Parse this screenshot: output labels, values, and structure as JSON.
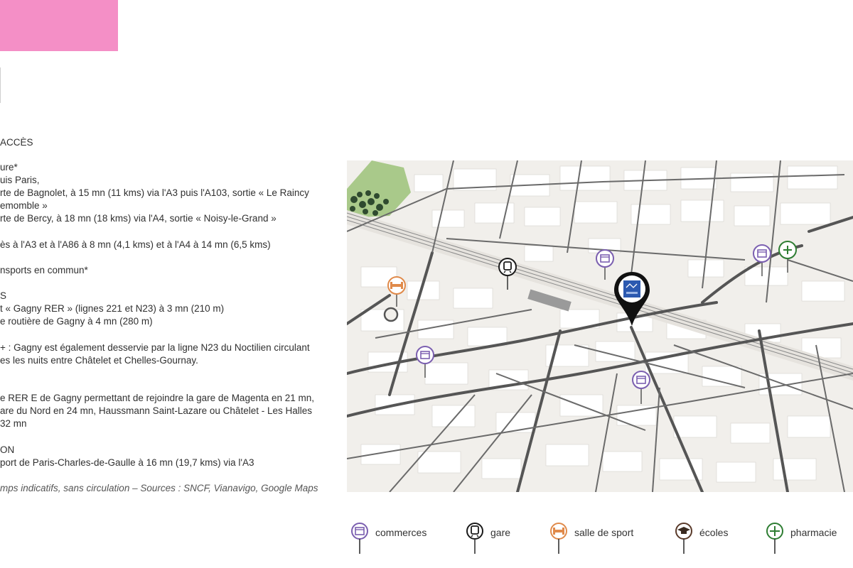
{
  "text": {
    "heading": "ACCÈS",
    "lines": [
      "ure*",
      "uis Paris,",
      "rte de Bagnolet, à 15 mn (11 kms) via l'A3 puis l'A103, sortie « Le Raincy",
      "emomble »",
      "rte de Bercy, à 18 mn (18 kms) via l'A4, sortie « Noisy-le-Grand »",
      "ès à l'A3 et à l'A86 à 8 mn (4,1 kms) et à l'A4 à 14 mn (6,5 kms)",
      "nsports en commun*",
      "S",
      "t « Gagny RER » (lignes 221 et N23) à 3 mn (210 m)",
      "e routière de Gagny à 4 mn (280 m)",
      "+ : Gagny est également desservie par la ligne N23 du Noctilien circulant",
      "es les nuits entre Châtelet et Chelles-Gournay.",
      "e RER E de Gagny permettant de rejoindre la gare de Magenta en 21 mn,",
      "are du Nord en 24 mn, Haussmann Saint-Lazare ou Châtelet - Les Halles",
      "32 mn",
      "ON",
      "port de Paris-Charles-de-Gaulle à 16 mn (19,7 kms) via l'A3"
    ],
    "footnote": "mps indicatifs, sans circulation – Sources : SNCF, Vianavigo, Google Maps"
  },
  "legend": [
    {
      "label": "commerces",
      "icon": "commerces-icon",
      "color": "#7b5fb0"
    },
    {
      "label": "gare",
      "icon": "gare-icon",
      "color": "#1a1a1a"
    },
    {
      "label": "salle de sport",
      "icon": "salle-de-sport-icon",
      "color": "#e08a4a"
    },
    {
      "label": "écoles",
      "icon": "ecoles-icon",
      "color": "#5a3a2a"
    },
    {
      "label": "pharmacie",
      "icon": "pharmacie-icon",
      "color": "#2e7d32"
    }
  ],
  "colors": {
    "accent_pink": "#f48fc6",
    "map_background": "#f1efeb",
    "map_roads": "#5a5a5a",
    "location_pin": "#111111",
    "location_logo": "#2b59b0"
  }
}
